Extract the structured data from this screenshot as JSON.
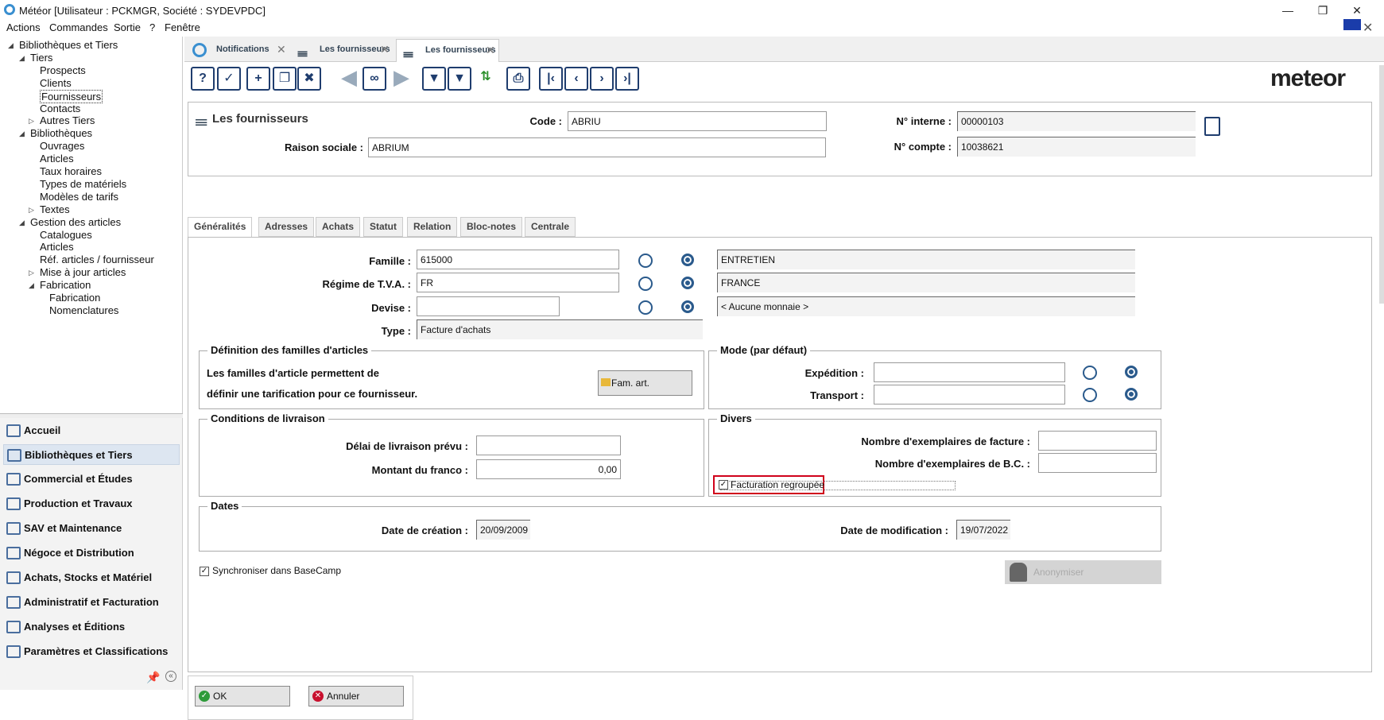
{
  "window": {
    "title": "Météor [Utilisateur : PCKMGR, Société : SYDEVPDC]"
  },
  "menu": [
    "Actions",
    "Commandes",
    "Sortie",
    "?",
    "Fenêtre"
  ],
  "tree": [
    {
      "label": "Bibliothèques et Tiers",
      "level": 0,
      "tri": "◢"
    },
    {
      "label": "Tiers",
      "level": 1,
      "tri": "◢"
    },
    {
      "label": "Prospects",
      "level": 2
    },
    {
      "label": "Clients",
      "level": 2
    },
    {
      "label": "Fournisseurs",
      "level": 2
    },
    {
      "label": "Contacts",
      "level": 2
    },
    {
      "label": "Autres Tiers",
      "level": 2,
      "tri": "▷"
    },
    {
      "label": "Bibliothèques",
      "level": 1,
      "tri": "◢"
    },
    {
      "label": "Ouvrages",
      "level": 2
    },
    {
      "label": "Articles",
      "level": 2
    },
    {
      "label": "Taux horaires",
      "level": 2
    },
    {
      "label": "Types de matériels",
      "level": 2
    },
    {
      "label": "Modèles de tarifs",
      "level": 2
    },
    {
      "label": "Textes",
      "level": 2,
      "tri": "▷"
    },
    {
      "label": "Gestion des articles",
      "level": 1,
      "tri": "◢"
    },
    {
      "label": "Catalogues",
      "level": 2
    },
    {
      "label": "Articles",
      "level": 2
    },
    {
      "label": "Réf. articles / fournisseur",
      "level": 2
    },
    {
      "label": "Mise à jour articles",
      "level": 2,
      "tri": "▷"
    },
    {
      "label": "Fabrication",
      "level": 2,
      "tri": "◢"
    },
    {
      "label": "Fabrication",
      "level": 3
    },
    {
      "label": "Nomenclatures",
      "level": 3
    }
  ],
  "nav": [
    "Accueil",
    "Bibliothèques et Tiers",
    "Commercial et Études",
    "Production et Travaux",
    "SAV et Maintenance",
    "Négoce et Distribution",
    "Achats, Stocks et Matériel",
    "Administratif et Facturation",
    "Analyses et Éditions",
    "Paramètres et Classifications"
  ],
  "doc_tabs": [
    "Notifications",
    "Les fournisseurs",
    "Les fournisseurs"
  ],
  "logo": "meteor",
  "header": {
    "title": "Les fournisseurs",
    "code_label": "Code :",
    "code": "ABRIU",
    "raison_label": "Raison sociale :",
    "raison": "ABRIUM",
    "interne_label": "N° interne :",
    "interne": "00000103",
    "compte_label": "N° compte :",
    "compte": "10038621"
  },
  "form_tabs": [
    "Généralités",
    "Adresses",
    "Achats",
    "Statut",
    "Relation",
    "Bloc-notes",
    "Centrale"
  ],
  "general": {
    "famille_label": "Famille :",
    "famille": "615000",
    "famille_desc": "ENTRETIEN",
    "tva_label": "Régime de T.V.A. :",
    "tva": "FR",
    "tva_desc": "FRANCE",
    "devise_label": "Devise :",
    "devise": "",
    "devise_desc": "< Aucune monnaie >",
    "type_label": "Type :",
    "type": "Facture d'achats"
  },
  "familles": {
    "title": "Définition des familles d'articles",
    "line1": "Les familles d'article permettent de",
    "line2": "définir une tarification pour ce fournisseur.",
    "button": "Fam. art."
  },
  "mode": {
    "title": "Mode (par défaut)",
    "expedition_label": "Expédition :",
    "expedition": "",
    "transport_label": "Transport :",
    "transport": ""
  },
  "livraison": {
    "title": "Conditions de livraison",
    "delai_label": "Délai de livraison prévu :",
    "delai": "",
    "franco_label": "Montant du franco :",
    "franco": "0,00"
  },
  "divers": {
    "title": "Divers",
    "nb_fact_label": "Nombre d'exemplaires de facture :",
    "nb_fact": "",
    "nb_bc_label": "Nombre d'exemplaires de B.C. :",
    "nb_bc": "",
    "regroupee_label": "Facturation regroupée",
    "regroupee": "✓"
  },
  "dates": {
    "title": "Dates",
    "creation_label": "Date de création :",
    "creation": "20/09/2009",
    "modif_label": "Date de modification :",
    "modif": "19/07/2022"
  },
  "sync": {
    "label": "Synchroniser dans BaseCamp",
    "checked": "✓"
  },
  "anonymiser": "Anonymiser",
  "footer": {
    "ok": "OK",
    "cancel": "Annuler"
  },
  "colors": {
    "accent": "#1f3d6e",
    "highlight": "#d0021b"
  }
}
